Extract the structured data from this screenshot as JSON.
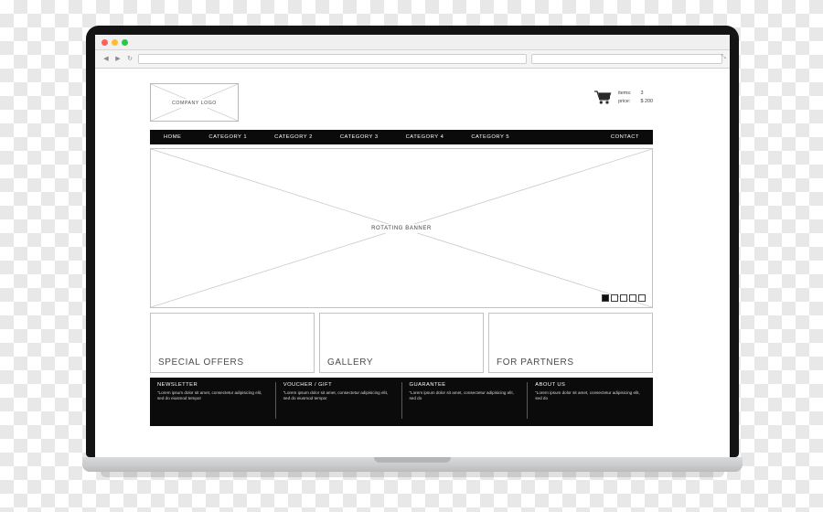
{
  "browser": {
    "traffic_lights": [
      "close",
      "minimize",
      "zoom"
    ],
    "nav_back": "◀",
    "nav_forward": "▶",
    "nav_reload": "↻",
    "url_value": "",
    "url_placeholder": "",
    "search_value": "",
    "search_placeholder": "",
    "search_icon": "search-icon",
    "resize_glyph": "⤡"
  },
  "site": {
    "logo_text": "COMPANY LOGO",
    "cart": {
      "icon": "shopping-cart-icon",
      "labels": [
        "items:",
        "price:"
      ],
      "values": [
        "3",
        "$ 200"
      ]
    },
    "nav": [
      "HOME",
      "CATEGORY 1",
      "CATEGORY 2",
      "CATEGORY 3",
      "CATEGORY 4",
      "CATEGORY 5",
      "CONTACT"
    ],
    "banner": {
      "label": "ROTATING BANNER",
      "slides": 5,
      "active_slide": 1
    },
    "promos": [
      {
        "label": "SPECIAL OFFERS"
      },
      {
        "label": "GALLERY"
      },
      {
        "label": "FOR PARTNERS"
      }
    ],
    "footer": [
      {
        "title": "NEWSLETTER",
        "text": "“Lorem ipsum dolor sit amet, consectetur adipisicing elit, sed do eiusmod tempor"
      },
      {
        "title": "VOUCHER / GIFT",
        "text": "“Lorem ipsum dolor sit amet, consectetur adipisicing elit, sed do eiusmod tempor"
      },
      {
        "title": "GUARANTEE",
        "text": "“Lorem ipsum dolor sit amet, consectetur adipisicing elit, sed do"
      },
      {
        "title": "ABOUT US",
        "text": "“Lorem ipsum dolor sit amet, consectetur adipisicing elit, sed do"
      }
    ]
  },
  "colors": {
    "nav_bg": "#0b0b0b",
    "wire_line": "#c2c2c2",
    "text_dark": "#3f3f3f"
  }
}
